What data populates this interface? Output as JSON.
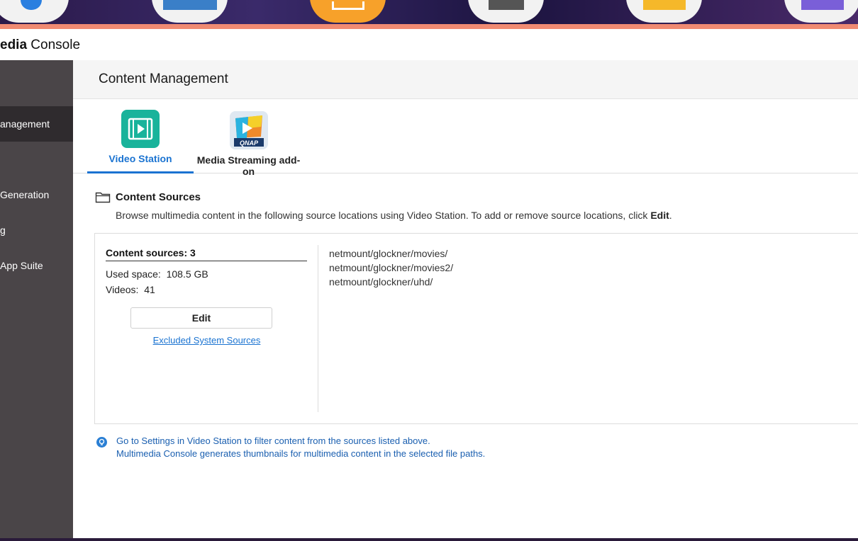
{
  "app": {
    "title_bold": "edia",
    "title_rest": " Console"
  },
  "sidebar": {
    "items": [
      {
        "label": "anagement",
        "active": true
      },
      {
        "label": "Generation",
        "active": false
      },
      {
        "label": "g",
        "active": false
      },
      {
        "label": "App Suite",
        "active": false
      }
    ]
  },
  "page": {
    "title": "Content Management"
  },
  "tabs": [
    {
      "label": "Video Station",
      "active": true,
      "icon": "video-station-icon"
    },
    {
      "label": "Media Streaming add-on",
      "active": false,
      "icon": "media-streaming-icon"
    }
  ],
  "media_icon_text": "QNAP",
  "section": {
    "title": "Content Sources",
    "desc_prefix": "Browse multimedia content in the following source locations using Video Station. To add or remove source locations, click ",
    "desc_bold": "Edit",
    "desc_suffix": "."
  },
  "summary": {
    "count_label": "Content sources: 3",
    "used_space_label": "Used space:",
    "used_space_value": "108.5 GB",
    "videos_label": "Videos:",
    "videos_value": "41",
    "edit_label": "Edit",
    "excluded_link": "Excluded System Sources"
  },
  "paths": [
    "netmount/glockner/movies/",
    "netmount/glockner/movies2/",
    "netmount/glockner/uhd/"
  ],
  "notes": [
    "Go to Settings in Video Station to filter content from the sources listed above.",
    "Multimedia Console generates thumbnails for multimedia content in the selected file paths."
  ],
  "colors": {
    "accent": "#1a73d1",
    "sidebar_bg": "#4a4548",
    "sidebar_active": "#2f2b2e",
    "video_station": "#19b39b",
    "top_bar": "#f08a72"
  }
}
